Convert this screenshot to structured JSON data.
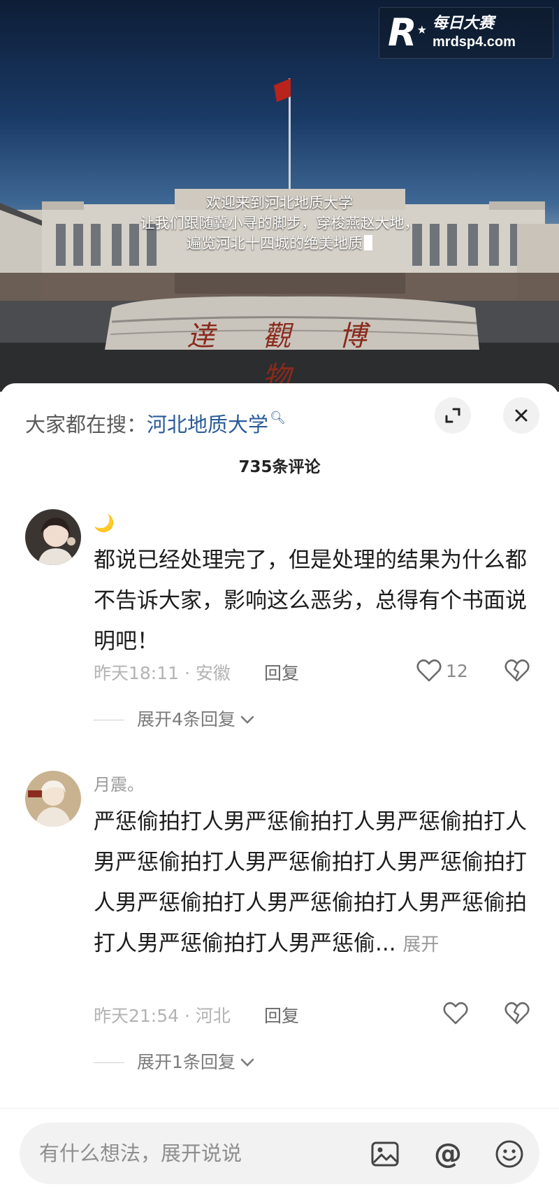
{
  "watermark": {
    "logo_letter": "R",
    "logo_star": "★",
    "brand_name": "每日大赛",
    "url": "mrdsp4.com"
  },
  "video": {
    "subtitle_lines": [
      "欢迎来到河北地质大学",
      "让我们跟随冀小寻的脚步，穿梭燕赵大地，",
      "遍览河北十四城的绝美地质"
    ],
    "stone_inscription": "逹 觀 博 物"
  },
  "sheet": {
    "search_prefix": "大家都在搜：",
    "search_term": "河北地质大学",
    "search_icon": "search-icon",
    "comment_count": "735条评论",
    "expand_icon": "expand-corner-icon",
    "close_icon": "close-icon"
  },
  "comments": [
    {
      "username": "🌙",
      "text": "都说已经处理完了，但是处理的结果为什么都不告诉大家，影响这么恶劣，总得有个书面说明吧！",
      "time": "昨天18:11",
      "location": "安徽",
      "meta": "昨天18:11 · 安徽",
      "reply_label": "回复",
      "likes": "12",
      "expand_replies": "展开4条回复"
    },
    {
      "username": "月震。",
      "text": "严惩偷拍打人男严惩偷拍打人男严惩偷拍打人男严惩偷拍打人男严惩偷拍打人男严惩偷拍打人男严惩偷拍打人男严惩偷拍打人男严惩偷拍打人男严惩偷拍打人男严惩偷...",
      "more_label": "展开",
      "time": "昨天21:54",
      "location": "河北",
      "meta": "昨天21:54 · 河北",
      "reply_label": "回复",
      "likes": "",
      "expand_replies": "展开1条回复"
    }
  ],
  "input": {
    "placeholder": "有什么想法，展开说说",
    "image_icon": "image-icon",
    "at_symbol": "@",
    "emoji_icon": "emoji-icon"
  }
}
